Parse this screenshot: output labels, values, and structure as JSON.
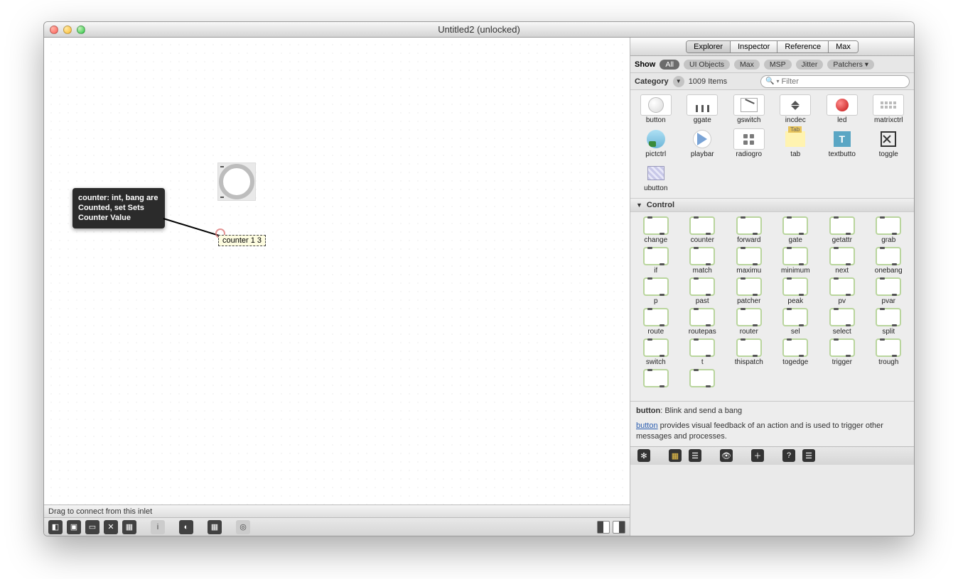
{
  "window": {
    "title": "Untitled2 (unlocked)"
  },
  "canvas": {
    "counter_text": "counter 1 3",
    "tooltip": "counter: int, bang are Counted, set Sets Counter Value",
    "status": "Drag to connect from this inlet"
  },
  "tabs": {
    "items": [
      "Explorer",
      "Inspector",
      "Reference",
      "Max"
    ],
    "active": 0
  },
  "filter": {
    "label": "Show",
    "pills": [
      "All",
      "UI Objects",
      "Max",
      "MSP",
      "Jitter",
      "Patchers ▾"
    ],
    "active": 0
  },
  "category": {
    "label": "Category",
    "count": "1009 Items",
    "search_placeholder": "Filter"
  },
  "palette": {
    "row1": [
      "button",
      "ggate",
      "gswitch",
      "incdec",
      "led",
      "matrixctrl"
    ],
    "row2": [
      "pictctrl",
      "playbar",
      "radiogro",
      "tab",
      "textbutto",
      "toggle"
    ],
    "row3": [
      "ubutton"
    ]
  },
  "control": {
    "title": "Control",
    "rows": [
      [
        "change",
        "counter",
        "forward",
        "gate",
        "getattr",
        "grab"
      ],
      [
        "if",
        "match",
        "maximu",
        "minimum",
        "next",
        "onebang"
      ],
      [
        "p",
        "past",
        "patcher",
        "peak",
        "pv",
        "pvar"
      ],
      [
        "route",
        "routepas",
        "router",
        "sel",
        "select",
        "split"
      ],
      [
        "switch",
        "t",
        "thispatch",
        "togedge",
        "trigger",
        "trough"
      ]
    ],
    "tail": [
      "",
      ""
    ]
  },
  "help": {
    "title_bold": "button",
    "title_rest": ": Blink and send a bang",
    "link_text": "button",
    "desc_rest": " provides visual feedback of an action and is used to trigger other messages and processes."
  }
}
